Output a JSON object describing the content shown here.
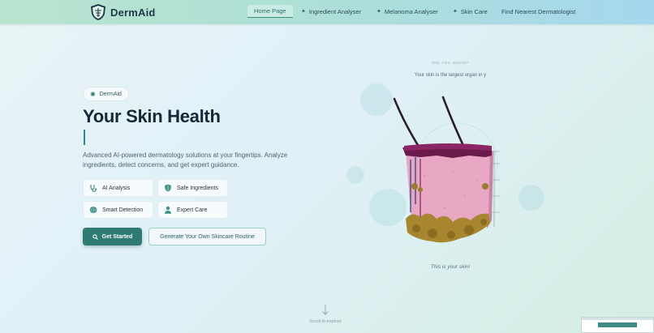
{
  "nav": {
    "brand": "DermAid",
    "items": [
      {
        "label": "Home Page",
        "icon": "",
        "active": true
      },
      {
        "label": "Ingredient Analyser",
        "icon": "sparkles-icon",
        "active": false
      },
      {
        "label": "Melanoma Analyser",
        "icon": "sparkles-icon",
        "active": false
      },
      {
        "label": "Skin Care",
        "icon": "sparkles-icon",
        "active": false
      },
      {
        "label": "Find Nearest Dermatologist",
        "icon": "",
        "active": false
      }
    ]
  },
  "hero": {
    "tag": "DermAid",
    "title": "Your Skin Health",
    "description": "Advanced AI-powered dermatology solutions at your fingertips. Analyze ingredients, detect concerns, and get expert guidance.",
    "features": [
      {
        "label": "AI Analysis",
        "icon": "stethoscope-icon"
      },
      {
        "label": "Safe Ingredients",
        "icon": "shield-icon"
      },
      {
        "label": "Smart Detection",
        "icon": "brain-icon"
      },
      {
        "label": "Expert Care",
        "icon": "user-icon"
      }
    ],
    "primary_button": "Get Started",
    "secondary_button": "Generate Your Own Skincare Routine"
  },
  "visual": {
    "did_you_know_label": "DID YOU KNOW?",
    "fact": "Your skin is the largest organ in y",
    "caption": "This is your skin!"
  },
  "scroll": {
    "label": "Scroll to explore"
  },
  "colors": {
    "accent": "#2f7a72",
    "title": "#142a36"
  }
}
